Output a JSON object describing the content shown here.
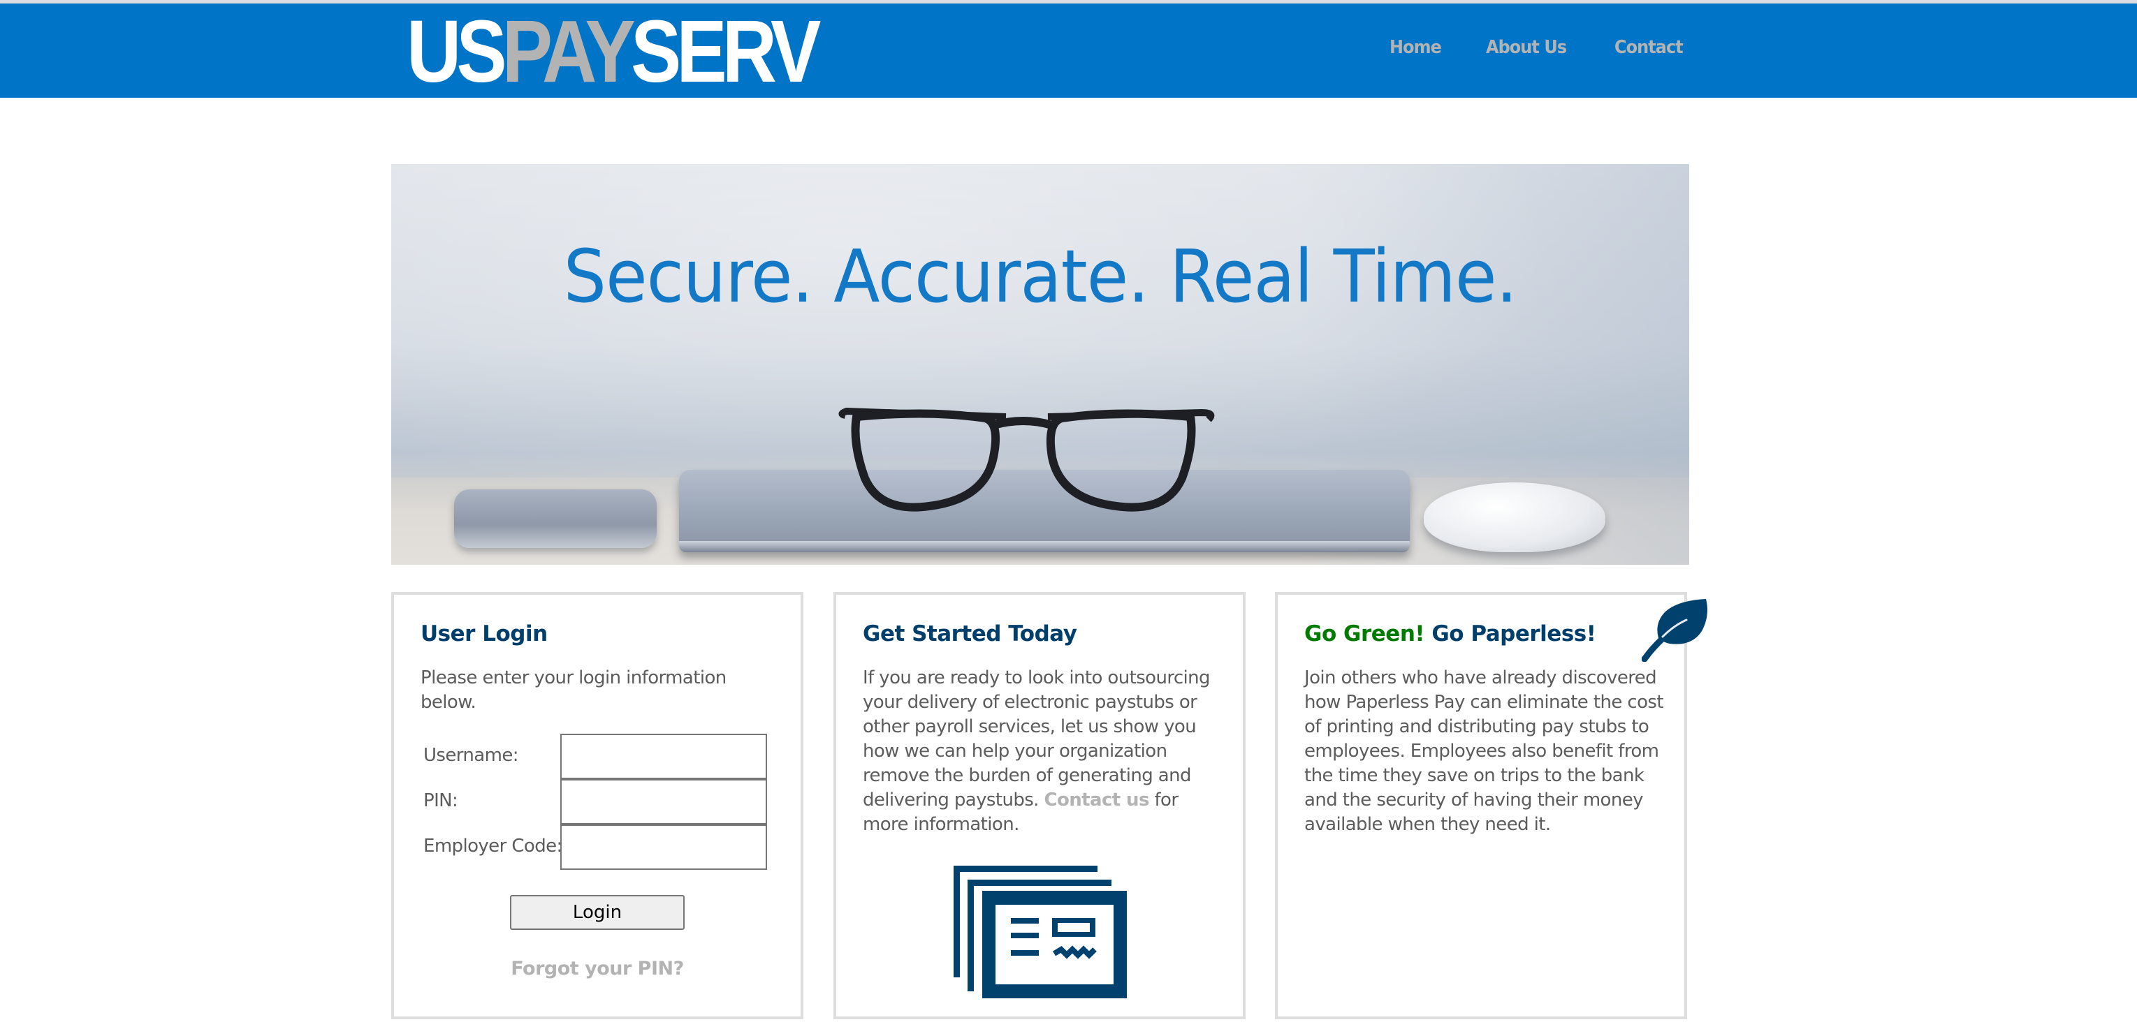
{
  "header": {
    "logo": {
      "part1": "US",
      "part2": "PAY",
      "part3": "SERV"
    },
    "nav": [
      {
        "label": "Home"
      },
      {
        "label": "About Us"
      },
      {
        "label": "Contact"
      }
    ]
  },
  "hero": {
    "tagline": "Secure. Accurate. Real Time."
  },
  "colors": {
    "header_bg": "#0074c6",
    "logo_accent": "#b3b3b3",
    "heading": "#003e6b",
    "green": "#007a00",
    "body_text": "#5c5c5c",
    "link": "#b3b3b3"
  },
  "login_panel": {
    "title": "User Login",
    "intro": "Please enter your login information below.",
    "fields": [
      {
        "label": "Username:",
        "value": "",
        "placeholder": ""
      },
      {
        "label": "PIN:",
        "value": "",
        "placeholder": ""
      },
      {
        "label": "Employer Code:",
        "value": "",
        "placeholder": ""
      }
    ],
    "login_button": "Login",
    "forgot_link": "Forgot your PIN?"
  },
  "get_started_panel": {
    "title": "Get Started Today",
    "body_before_link": "If you are ready to look into outsourcing your delivery of electronic paystubs or other payroll services, let us show you how we can help your organization remove the burden of generating and delivering paystubs. ",
    "link_text": "Contact us",
    "body_after_link": " for more information.",
    "icon": "paystub-stack-icon"
  },
  "paperless_panel": {
    "title_green": "Go Green!",
    "title_rest": " Go Paperless!",
    "body": "Join others who have already discovered how Paperless Pay can eliminate the cost of printing and distributing pay stubs to employees. Employees also benefit from the time they save on trips to the bank and the security of having their money available when they need it.",
    "icon": "leaf-icon"
  }
}
